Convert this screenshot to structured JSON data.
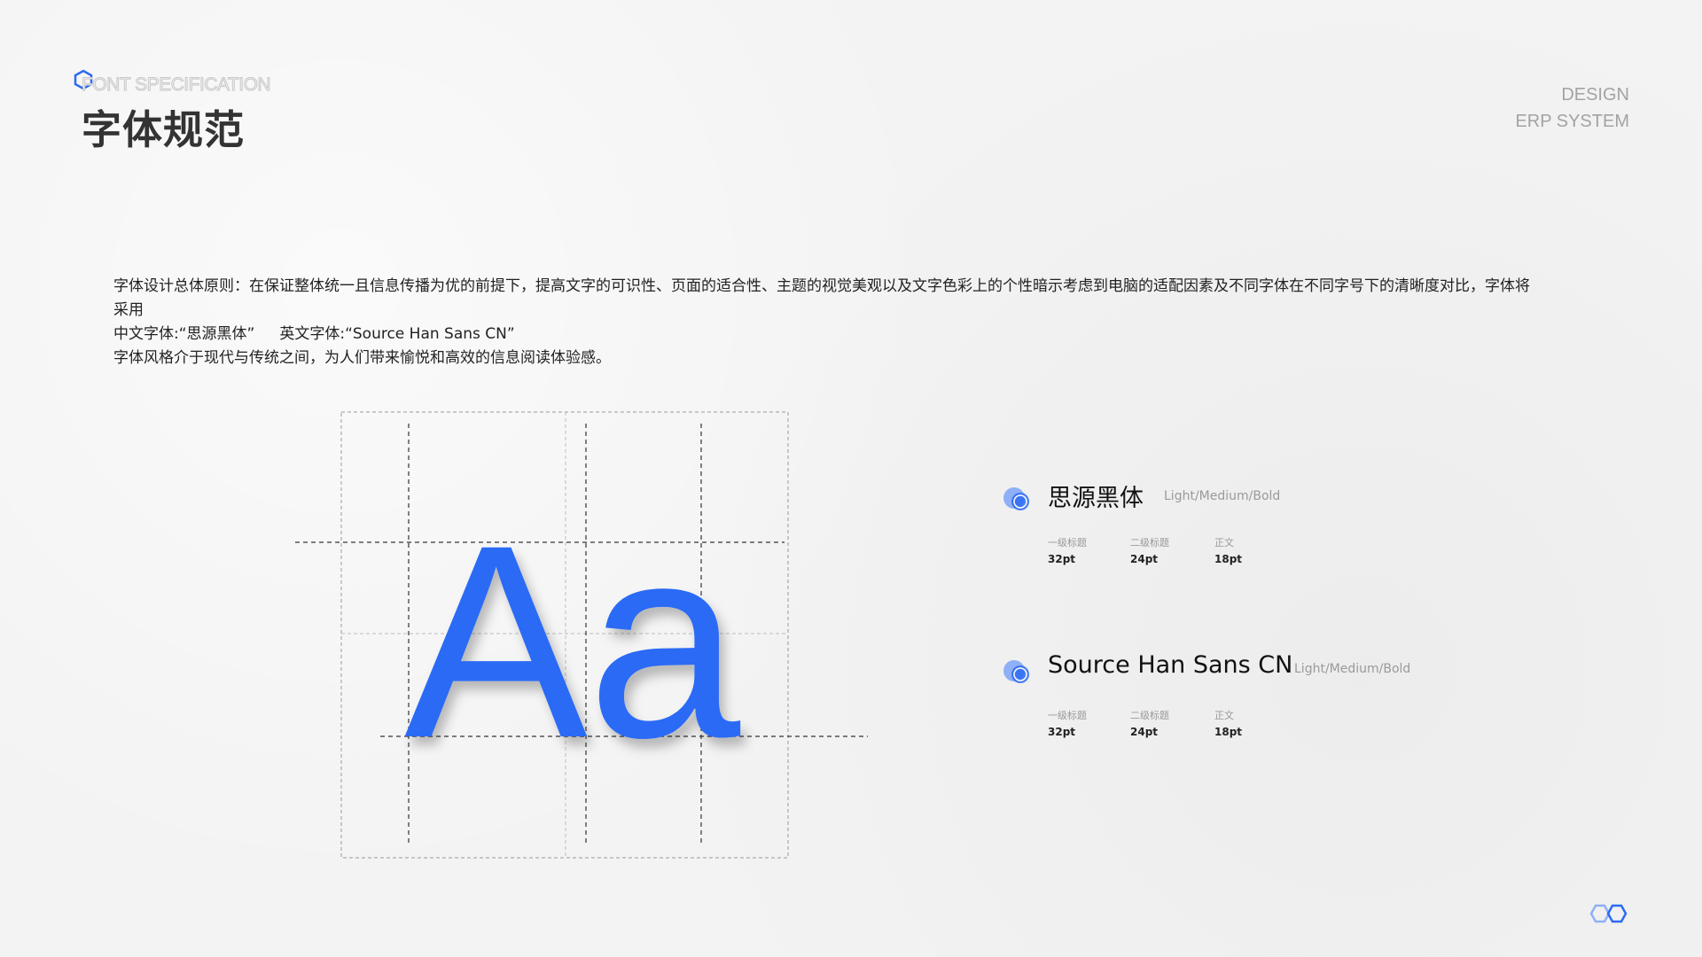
{
  "header": {
    "eyebrow": "FONT SPECIFICATION",
    "title": "字体规范",
    "brand_line1": "DESIGN",
    "brand_line2": "ERP SYSTEM"
  },
  "intro": {
    "line1": "字体设计总体原则：在保证整体统一且信息传播为优的前提下，提高文字的可识性、页面的适合性、主题的视觉美观以及文字色彩上的个性暗示考虑到电脑的适配因素及不同字体在不同字号下的清晰度对比，字体将采用",
    "cn_font": "中文字体:“思源黑体”",
    "en_font": "英文字体:“Source Han Sans CN”",
    "line3": "字体风格介于现代与传统之间，为人们带来愉悦和高效的信息阅读体验感。"
  },
  "specimen": {
    "glyphs": "Aa"
  },
  "fonts": [
    {
      "name": "思源黑体",
      "weights": "Light/Medium/Bold",
      "sizes": [
        {
          "label": "一级标题",
          "value": "32pt"
        },
        {
          "label": "二级标题",
          "value": "24pt"
        },
        {
          "label": "正文",
          "value": "18pt"
        }
      ]
    },
    {
      "name": "Source Han Sans CN",
      "weights": "Light/Medium/Bold",
      "sizes": [
        {
          "label": "一级标题",
          "value": "32pt"
        },
        {
          "label": "二级标题",
          "value": "24pt"
        },
        {
          "label": "正文",
          "value": "18pt"
        }
      ]
    }
  ],
  "colors": {
    "accent": "#2b6af5",
    "accent_light": "#8fb0f7",
    "text": "#222222",
    "muted": "#a3a3a3"
  },
  "icons": {
    "header_logo": "hexagon-icon",
    "font_bullet": "overlapping-circles-icon",
    "footer_logo": "double-hexagon-icon"
  }
}
